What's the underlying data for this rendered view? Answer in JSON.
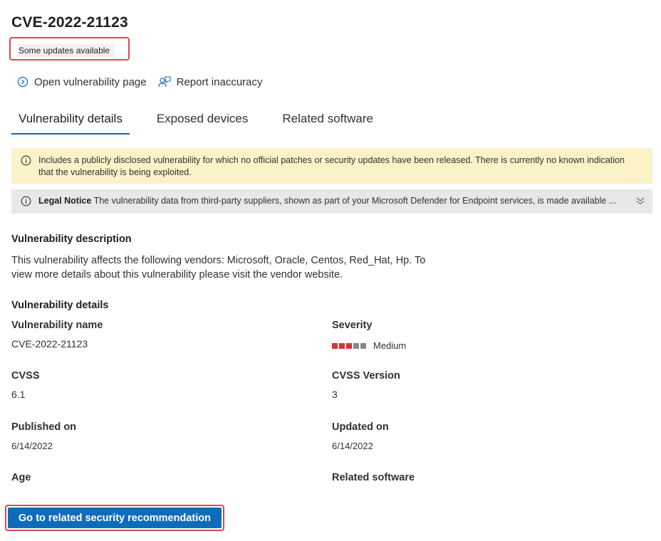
{
  "header": {
    "title": "CVE-2022-21123",
    "status_badge": "Some updates available"
  },
  "actions": {
    "open_page": "Open vulnerability page",
    "report": "Report inaccuracy"
  },
  "tabs": [
    {
      "label": "Vulnerability details",
      "active": true
    },
    {
      "label": "Exposed devices",
      "active": false
    },
    {
      "label": "Related software",
      "active": false
    }
  ],
  "banners": {
    "warning_line1": "Includes a publicly disclosed vulnerability for which no official patches or security updates have been released. There is currently no known indication",
    "warning_line2": "that the vulnerability is being exploited.",
    "legal_title": "Legal Notice",
    "legal_text": "The vulnerability data from third-party suppliers, shown as part of your Microsoft Defender for Endpoint services, is made available ..."
  },
  "description": {
    "heading": "Vulnerability description",
    "line1": "This vulnerability affects the following vendors: Microsoft, Oracle, Centos, Red_Hat, Hp. To",
    "line2": "view more details about this vulnerability please visit the vendor website."
  },
  "details": {
    "heading": "Vulnerability details",
    "name_label": "Vulnerability name",
    "name_value": "CVE-2022-21123",
    "severity_label": "Severity",
    "severity_value": "Medium",
    "severity_level": 3,
    "severity_max": 5,
    "cvss_label": "CVSS",
    "cvss_value": "6.1",
    "cvss_version_label": "CVSS Version",
    "cvss_version_value": "3",
    "published_label": "Published on",
    "published_value": "6/14/2022",
    "updated_label": "Updated on",
    "updated_value": "6/14/2022",
    "age_label": "Age",
    "related_label": "Related software"
  },
  "cta": {
    "label": "Go to related security recommendation"
  },
  "colors": {
    "accent": "#0f6cbd",
    "severity_filled": "#d13438",
    "severity_empty": "#8a8886",
    "warning_bg": "#fcf2c8",
    "highlight": "#e2474c"
  }
}
